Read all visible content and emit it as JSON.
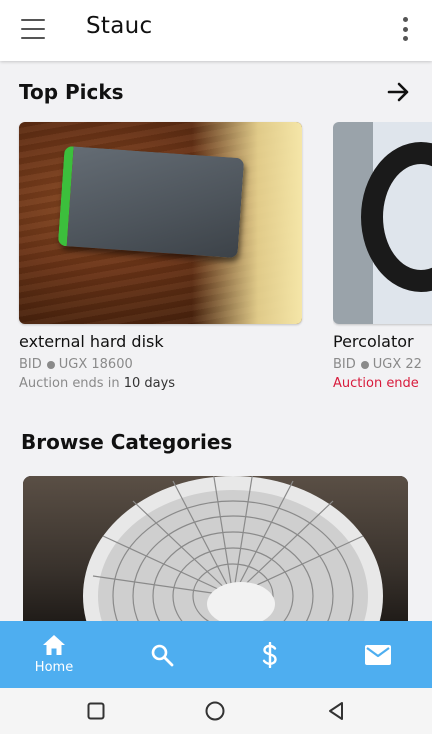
{
  "app": {
    "title": "Stauc"
  },
  "icons": {
    "menu": "hamburger-menu-icon",
    "more": "more-vert-icon",
    "arrow": "arrow-right-icon",
    "home": "home-icon",
    "search": "search-icon",
    "dollar": "dollar-icon",
    "mail": "mail-icon"
  },
  "top_picks": {
    "title": "Top Picks",
    "items": [
      {
        "name": "external hard disk",
        "bid_label": "BID",
        "price": "UGX 18600",
        "ends_prefix": "Auction ends in",
        "ends_value": "10 days",
        "urgent": false
      },
      {
        "name": "Percolator",
        "bid_label": "BID",
        "price": "UGX 22",
        "ends_prefix": "Auction ende",
        "ends_value": "",
        "urgent": true
      }
    ]
  },
  "browse": {
    "title": "Browse Categories"
  },
  "bottom_nav": {
    "items": [
      {
        "label": "Home",
        "active": true
      },
      {
        "label": "",
        "active": false
      },
      {
        "label": "",
        "active": false
      },
      {
        "label": "",
        "active": false
      }
    ]
  },
  "colors": {
    "accent": "#4eaef0",
    "urgent": "#d81b3c",
    "muted": "#8a8a8a"
  }
}
